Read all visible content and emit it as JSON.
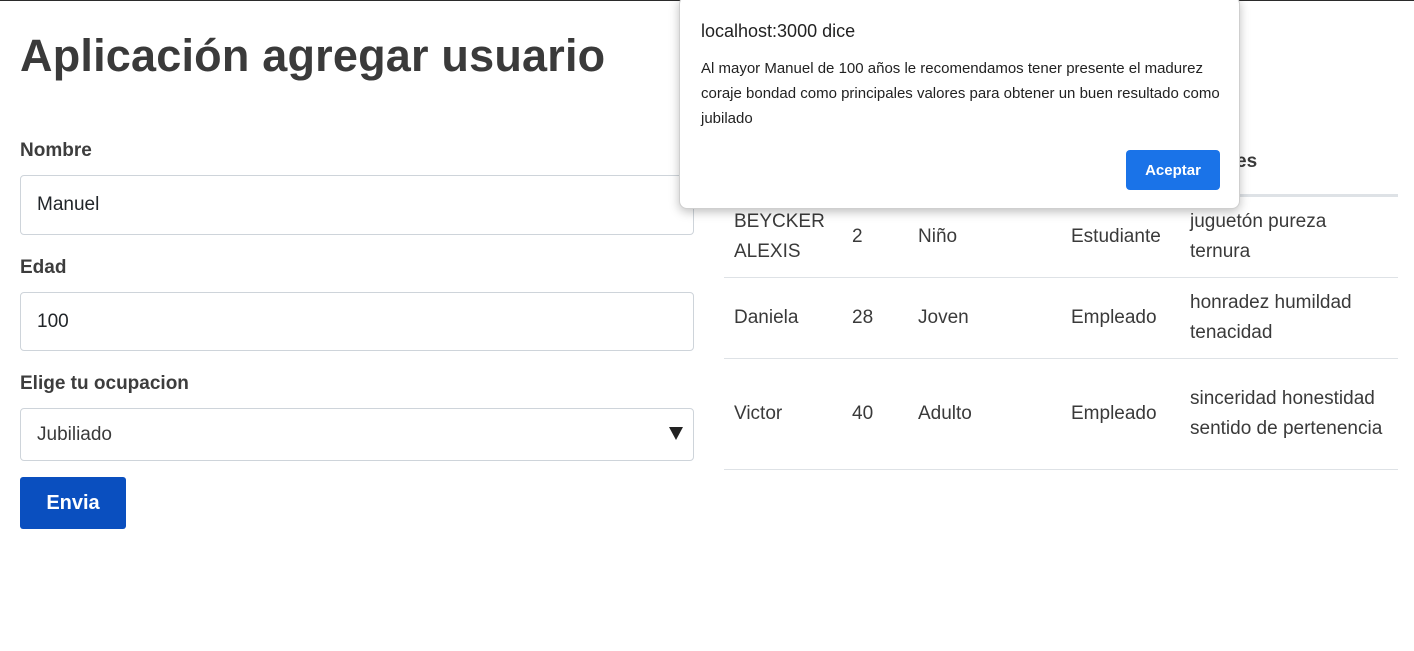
{
  "page": {
    "title": "Aplicación agregar usuario"
  },
  "form": {
    "name_label": "Nombre",
    "name_value": "Manuel",
    "age_label": "Edad",
    "age_value": "100",
    "occupation_label": "Elige tu ocupacion",
    "occupation_selected": "Jubiliado",
    "submit_label": "Envia"
  },
  "table": {
    "header_visible_fragment": "es",
    "rows": [
      {
        "name": "BEYCKER ALEXIS",
        "age": "2",
        "stage": "Niño",
        "occupation": "Estudiante",
        "values": "juguetón pureza ternura"
      },
      {
        "name": "Daniela",
        "age": "28",
        "stage": "Joven",
        "occupation": "Empleado",
        "values": "honradez humildad tenacidad"
      },
      {
        "name": "Victor",
        "age": "40",
        "stage": "Adulto",
        "occupation": "Empleado",
        "values": "sinceridad honestidad sentido de pertenencia"
      }
    ]
  },
  "dialog": {
    "title": "localhost:3000 dice",
    "message": "Al mayor Manuel de 100 años le recomendamos tener presente el madurez coraje bondad como principales valores para obtener un buen resultado como jubilado",
    "ok_label": "Aceptar"
  },
  "colors": {
    "submit_button": "#0a4fbf",
    "dialog_button": "#1a73e8",
    "heading_text": "#3a3a3a"
  },
  "icons": {
    "select_arrow": "caret-down-icon"
  }
}
